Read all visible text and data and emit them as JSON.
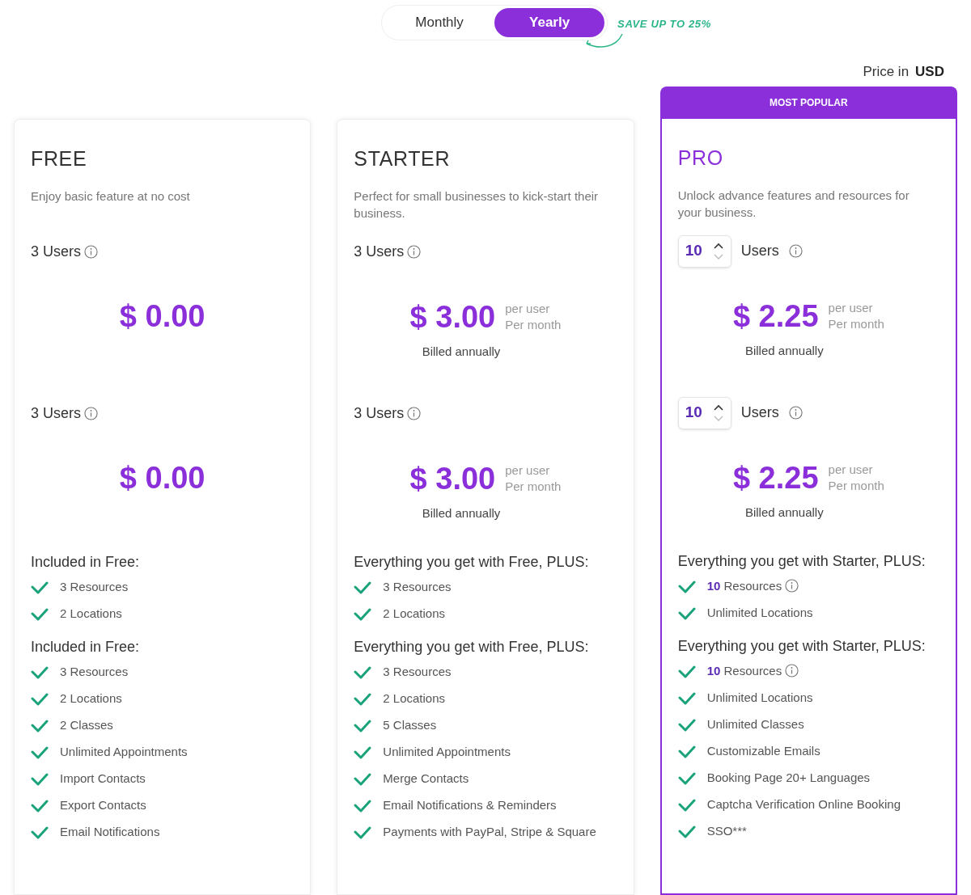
{
  "billing_toggle": [
    {
      "label": "Monthly",
      "selected": false
    },
    {
      "label": "Yearly",
      "selected": true
    }
  ],
  "save_note": "SAVE UP TO 25%",
  "currency": {
    "label": "Price in",
    "value": "USD"
  },
  "plans": [
    {
      "name": "FREE",
      "popular": false,
      "description": "Enjoy basic feature at no cost",
      "blocks": [
        {
          "users": {
            "kind": "static",
            "label": "3 Users"
          },
          "price": "$ 0.00"
        },
        {
          "users": {
            "kind": "static",
            "label": "3 Users"
          },
          "price": "$ 0.00"
        }
      ],
      "sections": [
        {
          "heading": "Included in Free:",
          "features": [
            {
              "text": "3 Resources"
            },
            {
              "text": "2 Locations"
            }
          ]
        },
        {
          "heading": "Included in Free:",
          "features": [
            {
              "text": "3 Resources"
            },
            {
              "text": "2 Locations"
            },
            {
              "text": "2 Classes"
            },
            {
              "text": "Unlimited Appointments"
            },
            {
              "text": "Import Contacts"
            },
            {
              "text": "Export Contacts"
            },
            {
              "text": "Email Notifications"
            }
          ]
        }
      ]
    },
    {
      "name": "STARTER",
      "popular": false,
      "description": "Perfect for small businesses to kick-start their business.",
      "blocks": [
        {
          "users": {
            "kind": "static",
            "label": "3 Users"
          },
          "price": "$ 3.00",
          "unit": "per user",
          "period": "Per month",
          "billing": "Billed annually"
        },
        {
          "users": {
            "kind": "static",
            "label": "3 Users"
          },
          "price": "$ 3.00",
          "unit": "per user",
          "period": "Per month",
          "billing": "Billed annually"
        }
      ],
      "sections": [
        {
          "heading": "Everything you get with Free, PLUS:",
          "features": [
            {
              "text": "3 Resources"
            },
            {
              "text": "2 Locations"
            }
          ]
        },
        {
          "heading": "Everything you get with Free, PLUS:",
          "features": [
            {
              "text": "3 Resources"
            },
            {
              "text": "2 Locations"
            },
            {
              "text": "5 Classes"
            },
            {
              "text": "Unlimited Appointments"
            },
            {
              "text": "Merge Contacts"
            },
            {
              "text": "Email Notifications & Reminders"
            },
            {
              "text": "Payments with PayPal, Stripe & Square"
            }
          ]
        }
      ]
    },
    {
      "name": "PRO",
      "popular": true,
      "badge": "MOST POPULAR",
      "description": "Unlock advance features and resources for your business.",
      "blocks": [
        {
          "users": {
            "kind": "stepper",
            "value": "10",
            "label": "Users"
          },
          "price": "$ 2.25",
          "unit": "per user",
          "period": "Per month",
          "billing": "Billed annually"
        },
        {
          "users": {
            "kind": "stepper",
            "value": "10",
            "label": "Users"
          },
          "price": "$ 2.25",
          "unit": "per user",
          "period": "Per month",
          "billing": "Billed annually"
        }
      ],
      "sections": [
        {
          "heading": "Everything you get with Starter, PLUS:",
          "features": [
            {
              "highlight": "10",
              "text": "Resources",
              "info": true
            },
            {
              "text": "Unlimited Locations"
            }
          ]
        },
        {
          "heading": "Everything you get with Starter, PLUS:",
          "features": [
            {
              "highlight": "10",
              "text": "Resources",
              "info": true
            },
            {
              "text": "Unlimited Locations"
            },
            {
              "text": "Unlimited Classes"
            },
            {
              "text": "Customizable Emails"
            },
            {
              "text": "Booking Page 20+ Languages"
            },
            {
              "text": "Captcha Verification Online Booking"
            },
            {
              "text": "SSO***"
            }
          ]
        }
      ]
    }
  ]
}
